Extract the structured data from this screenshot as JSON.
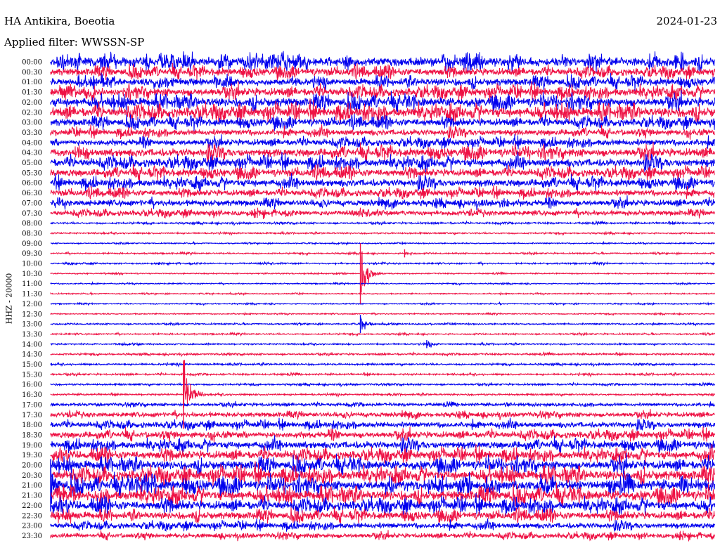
{
  "header": {
    "station": "HA Antikira, Boeotia",
    "date": "2024-01-23",
    "filter": "Applied filter: WWSSN-SP"
  },
  "channel_label": "HHZ - 20000",
  "colors": {
    "even_trace": "#0000ee",
    "odd_trace": "#ee1144"
  },
  "chart_data": {
    "type": "line",
    "title": "HA Antikira, Boeotia",
    "date": "2024-01-23",
    "subtitle": "Applied filter: WWSSN-SP",
    "ylabel": "HHZ - 20000",
    "row_interval_minutes": 30,
    "tick_labels": [
      "00:00",
      "00:30",
      "01:00",
      "01:30",
      "02:00",
      "02:30",
      "03:00",
      "03:30",
      "04:00",
      "04:30",
      "05:00",
      "05:30",
      "06:00",
      "06:30",
      "07:00",
      "07:30",
      "08:00",
      "08:30",
      "09:00",
      "09:30",
      "10:00",
      "10:30",
      "11:00",
      "11:30",
      "12:00",
      "12:30",
      "13:00",
      "13:30",
      "14:00",
      "14:30",
      "15:00",
      "15:30",
      "16:00",
      "16:30",
      "17:00",
      "17:30",
      "18:00",
      "18:30",
      "19:00",
      "19:30",
      "20:00",
      "20:30",
      "21:00",
      "21:30",
      "22:00",
      "22:30",
      "23:00",
      "23:30"
    ],
    "noise_level": [
      0.55,
      0.45,
      0.45,
      0.5,
      0.55,
      0.6,
      0.45,
      0.38,
      0.4,
      0.5,
      0.5,
      0.45,
      0.45,
      0.38,
      0.38,
      0.32,
      0.12,
      0.1,
      0.08,
      0.1,
      0.1,
      0.08,
      0.08,
      0.08,
      0.08,
      0.08,
      0.1,
      0.1,
      0.1,
      0.12,
      0.12,
      0.12,
      0.12,
      0.12,
      0.2,
      0.3,
      0.35,
      0.4,
      0.45,
      0.5,
      0.55,
      0.6,
      0.62,
      0.6,
      0.55,
      0.45,
      0.35,
      0.3
    ],
    "events": [
      {
        "time": "10:44",
        "row_span": 3.0
      },
      {
        "time": "13:14",
        "row_span": 0.9
      },
      {
        "time": "16:36",
        "row_span": 3.4
      },
      {
        "time": "21:00",
        "row_span": 2.6
      },
      {
        "time": "09:46",
        "row_span": 0.4
      },
      {
        "time": "14:17",
        "row_span": 0.4
      }
    ],
    "grid": false
  }
}
